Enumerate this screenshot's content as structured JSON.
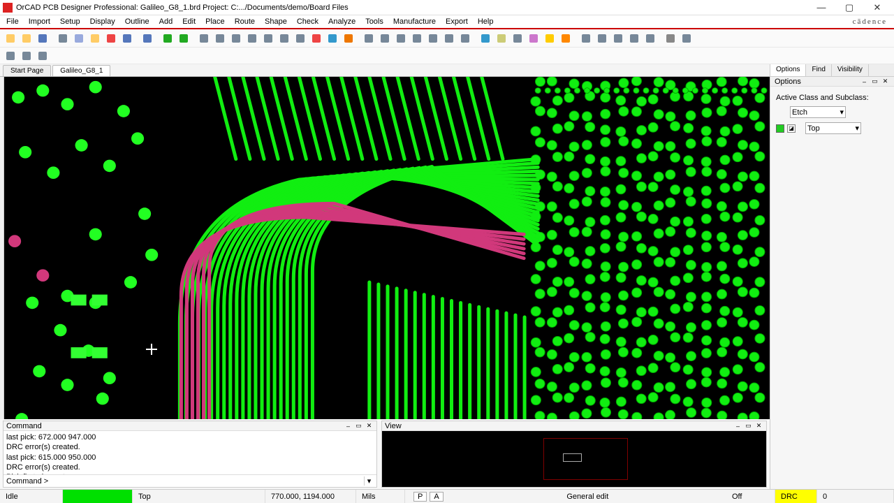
{
  "titlebar": {
    "title": "OrCAD PCB Designer Professional: Galileo_G8_1.brd  Project: C:.../Documents/demo/Board Files"
  },
  "menu": {
    "items": [
      "File",
      "Import",
      "Setup",
      "Display",
      "Outline",
      "Add",
      "Edit",
      "Place",
      "Route",
      "Shape",
      "Check",
      "Analyze",
      "Tools",
      "Manufacture",
      "Export",
      "Help"
    ],
    "brand": "cādence"
  },
  "toolbar1_icons": [
    "new",
    "open",
    "save",
    "sep",
    "hand",
    "copy",
    "paste",
    "delete",
    "undo",
    "sep",
    "redo",
    "sep",
    "go",
    "pin",
    "sep",
    "grid-list",
    "grid-table",
    "zoom-in",
    "zoom-fit",
    "zoom-out",
    "zoom-area",
    "zoom-sel",
    "stop",
    "refresh",
    "3d",
    "sep",
    "stack1",
    "stack2",
    "stack3",
    "stack4",
    "stack5",
    "stack6",
    "stack7",
    "sep",
    "globe",
    "gears",
    "box",
    "wand",
    "sun",
    "sun2",
    "sep",
    "win1",
    "win2",
    "win3",
    "win4",
    "win5",
    "sep",
    "print",
    "printopt"
  ],
  "toolbar2_icons": [
    "measure",
    "histogram",
    "align"
  ],
  "doc_tabs": {
    "items": [
      "Start Page",
      "Galileo_G8_1"
    ],
    "active_index": 1
  },
  "options_panel": {
    "tabs": [
      "Options",
      "Find",
      "Visibility"
    ],
    "subtitle": "Options",
    "section_label": "Active Class and Subclass:",
    "class_value": "Etch",
    "subclass_value": "Top",
    "subclass_color": "#22cc22"
  },
  "command_panel": {
    "title": "Command",
    "log": [
      "last pick:  672.000 947.000",
      "DRC error(s) created.",
      "last pick:  615.000 950.000",
      "DRC error(s) created.",
      "Pick first element."
    ],
    "prompt_label": "Command >",
    "prompt_value": ""
  },
  "view_panel": {
    "title": "View"
  },
  "status": {
    "idle": "Idle",
    "layer": "Top",
    "coords": "770.000, 1194.000",
    "units": "Mils",
    "btn_p": "P",
    "btn_a": "A",
    "mode": "General edit",
    "snap": "Off",
    "drc_label": "DRC",
    "drc_count": "0"
  },
  "canvas": {
    "crosshair_left_pct": 18.5,
    "crosshair_top_pct": 78
  }
}
